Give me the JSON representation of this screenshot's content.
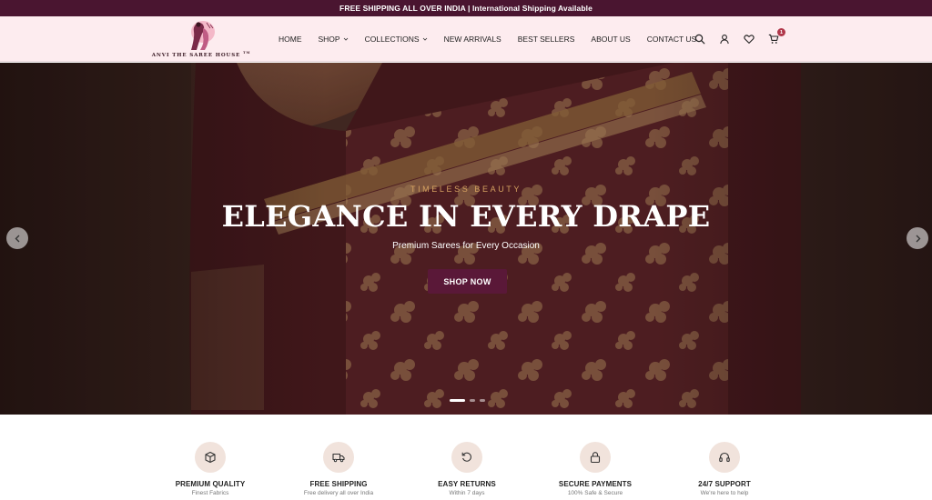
{
  "announcement": "FREE SHIPPING ALL OVER INDIA | International Shipping Available",
  "brand": {
    "name": "ANVI THE SAREE HOUSE",
    "mark": "TM",
    "logo_icon": "saree-silhouette-icon"
  },
  "nav": [
    {
      "label": "HOME",
      "has_dropdown": false
    },
    {
      "label": "SHOP",
      "has_dropdown": true
    },
    {
      "label": "COLLECTIONS",
      "has_dropdown": true
    },
    {
      "label": "NEW ARRIVALS",
      "has_dropdown": false
    },
    {
      "label": "BEST SELLERS",
      "has_dropdown": false
    },
    {
      "label": "ABOUT US",
      "has_dropdown": false
    },
    {
      "label": "CONTACT US",
      "has_dropdown": false
    }
  ],
  "actions": {
    "icons": [
      "search-icon",
      "user-icon",
      "heart-icon",
      "cart-icon"
    ],
    "cart_count": "1"
  },
  "hero": {
    "eyebrow": "TIMELESS BEAUTY",
    "headline": "ELEGANCE IN EVERY DRAPE",
    "subline": "Premium Sarees for Every Occasion",
    "cta_label": "SHOP NOW",
    "slide_count": 3,
    "active_slide": 1
  },
  "features": [
    {
      "icon": "box-icon",
      "title": "PREMIUM QUALITY",
      "subtitle": "Finest Fabrics"
    },
    {
      "icon": "truck-icon",
      "title": "FREE SHIPPING",
      "subtitle": "Free delivery all over India"
    },
    {
      "icon": "return-icon",
      "title": "EASY RETURNS",
      "subtitle": "Within 7 days"
    },
    {
      "icon": "lock-icon",
      "title": "SECURE PAYMENTS",
      "subtitle": "100% Safe & Secure"
    },
    {
      "icon": "headset-icon",
      "title": "24/7 SUPPORT",
      "subtitle": "We're here to help"
    }
  ],
  "colors": {
    "announcement_bg": "#4a1530",
    "header_bg": "#fdecef",
    "accent": "#5a1838",
    "eyebrow_gold": "#d4a060",
    "feature_icon_bg": "#f1e3dc",
    "badge": "#b0374a"
  }
}
